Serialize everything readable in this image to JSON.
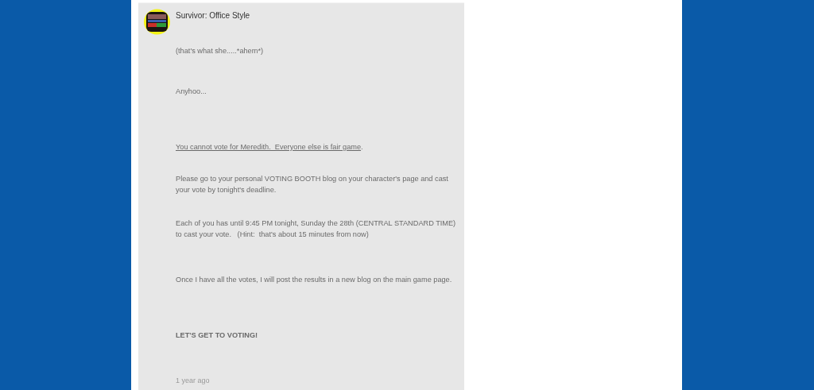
{
  "post": {
    "title": "Survivor: Office Style",
    "paragraphs": [
      {
        "kind": "plain",
        "text": "(that's what she.....*ahem*)"
      },
      {
        "kind": "plain",
        "text": "Anyhoo..."
      },
      {
        "kind": "underlined",
        "text": "You cannot vote for Meredith.  Everyone else is fair game",
        "after": "."
      },
      {
        "kind": "plain",
        "text": "Please go to your personal VOTING BOOTH blog on your character's page and cast your vote by tonight's deadline."
      },
      {
        "kind": "plain",
        "text": "Each of you has until 9:45 PM tonight, Sunday the 28th (CENTRAL STANDARD TIME) to cast your vote.   (Hint:  that's about 15 minutes from now)"
      },
      {
        "kind": "plain",
        "text": "Once I have all the votes, I will post the results in a new blog on the main game page."
      },
      {
        "kind": "bold",
        "text": "LET'S GET TO VOTING!"
      }
    ],
    "time": "1 year ago"
  }
}
